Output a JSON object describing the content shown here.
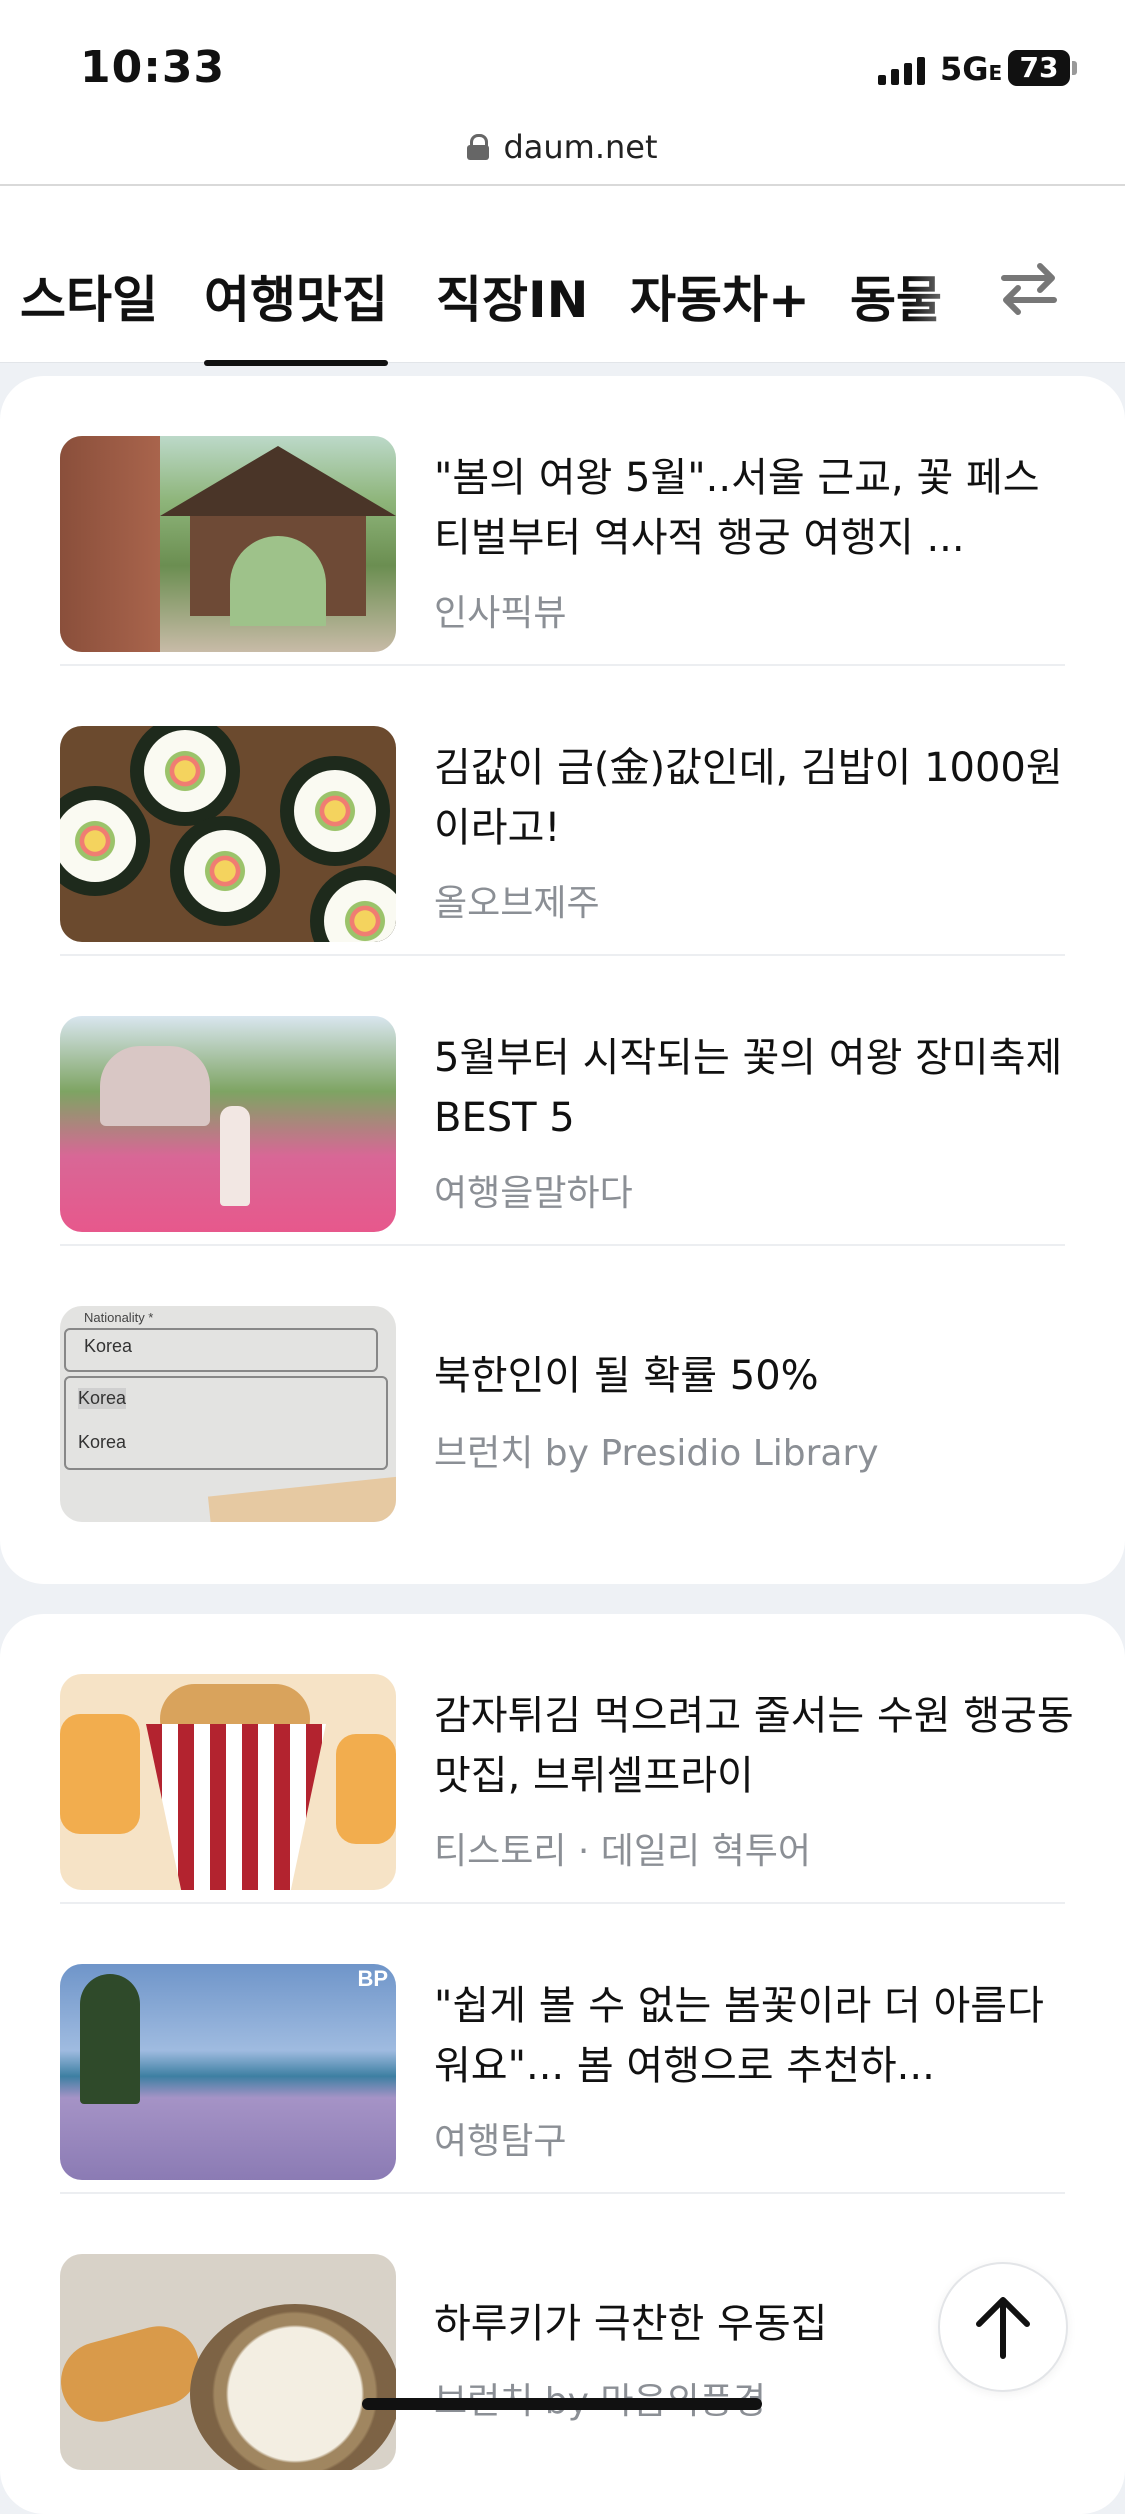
{
  "status_bar": {
    "time": "10:33",
    "network": "5G",
    "network_suffix": "E",
    "battery": "73"
  },
  "browser": {
    "url": "daum.net"
  },
  "tabs": [
    {
      "label": "스타일",
      "active": false
    },
    {
      "label": "여행맛집",
      "active": true
    },
    {
      "label": "직장IN",
      "active": false
    },
    {
      "label": "자동차+",
      "active": false
    },
    {
      "label": "동물",
      "active": false
    }
  ],
  "icons": {
    "tab_switch": "swap-arrows-icon",
    "scroll_top": "arrow-up-icon",
    "lock": "lock-icon"
  },
  "cards": [
    {
      "articles": [
        {
          "title": "\"봄의 여왕 5월\"..서울 근교, 꽃 페스티벌부터 역사적 행궁 여행지 ...",
          "source": "인사픽뷰",
          "thumb": "garden-gate"
        },
        {
          "title": "김값이 금(金)값인데, 김밥이 1000원이라고!",
          "source": "올오브제주",
          "thumb": "kimbap"
        },
        {
          "title": "5월부터 시작되는 꽃의 여왕 장미축제 BEST 5",
          "source": "여행을말하다",
          "thumb": "roses"
        },
        {
          "title": "북한인이 될 확률 50%",
          "source": "브런치 by Presidio Library",
          "thumb": "form",
          "thumb_text": {
            "label": "Nationality *",
            "field1": "Korea",
            "field2": "Korea",
            "field3": "Korea"
          }
        }
      ]
    },
    {
      "articles": [
        {
          "title": "감자튀김 먹으려고 줄서는 수원 행궁동 맛집, 브뤼셀프라이",
          "source": "티스토리 · 데일리 혁투어",
          "thumb": "fries"
        },
        {
          "title": "\"쉽게 볼 수 없는 봄꽃이라 더 아름다워요\"... 봄 여행으로 추천하...",
          "source": "여행탐구",
          "thumb": "flowers",
          "thumb_text": {
            "logo": "BP"
          }
        },
        {
          "title": "하루키가 극찬한 우동집",
          "source": "브런치 by 마음의풍경",
          "thumb": "udon"
        }
      ]
    }
  ],
  "colors": {
    "background": "#eef1f5",
    "card": "#ffffff",
    "text": "#111111",
    "muted": "#8b8f95"
  }
}
